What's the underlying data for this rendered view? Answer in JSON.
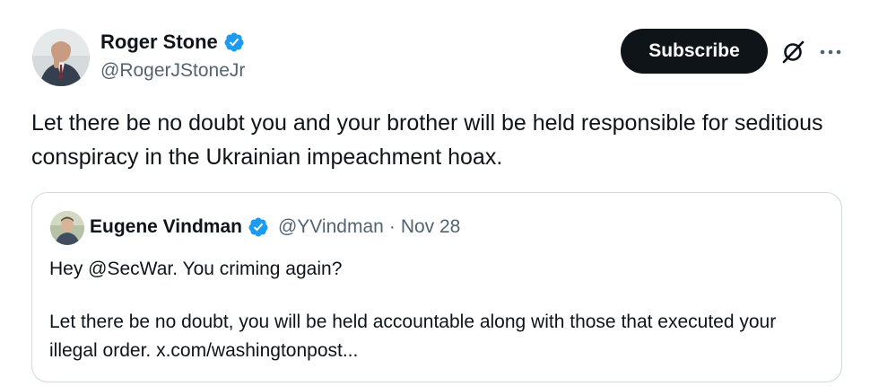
{
  "post": {
    "author_name": "Roger Stone",
    "author_handle": "@RogerJStoneJr",
    "subscribe_label": "Subscribe",
    "text": "Let there be no doubt you and your brother will be held responsible for seditious conspiracy in the Ukrainian impeachment hoax."
  },
  "quoted": {
    "author_name": "Eugene Vindman",
    "handle": "@YVindman",
    "separator": "·",
    "date": "Nov 28",
    "line1": "Hey @SecWar. You criming again?",
    "line2": "Let there be no doubt, you will be held accountable along with those that executed your illegal order. x.com/washingtonpost..."
  },
  "icons": {
    "verified": "verified-badge-icon",
    "grok": "grok-icon",
    "more": "more-options-icon"
  },
  "colors": {
    "verified_blue": "#1d9bf0",
    "text": "#0f1419",
    "secondary": "#536471",
    "border": "#cfd9de",
    "button_bg": "#0f1419"
  }
}
